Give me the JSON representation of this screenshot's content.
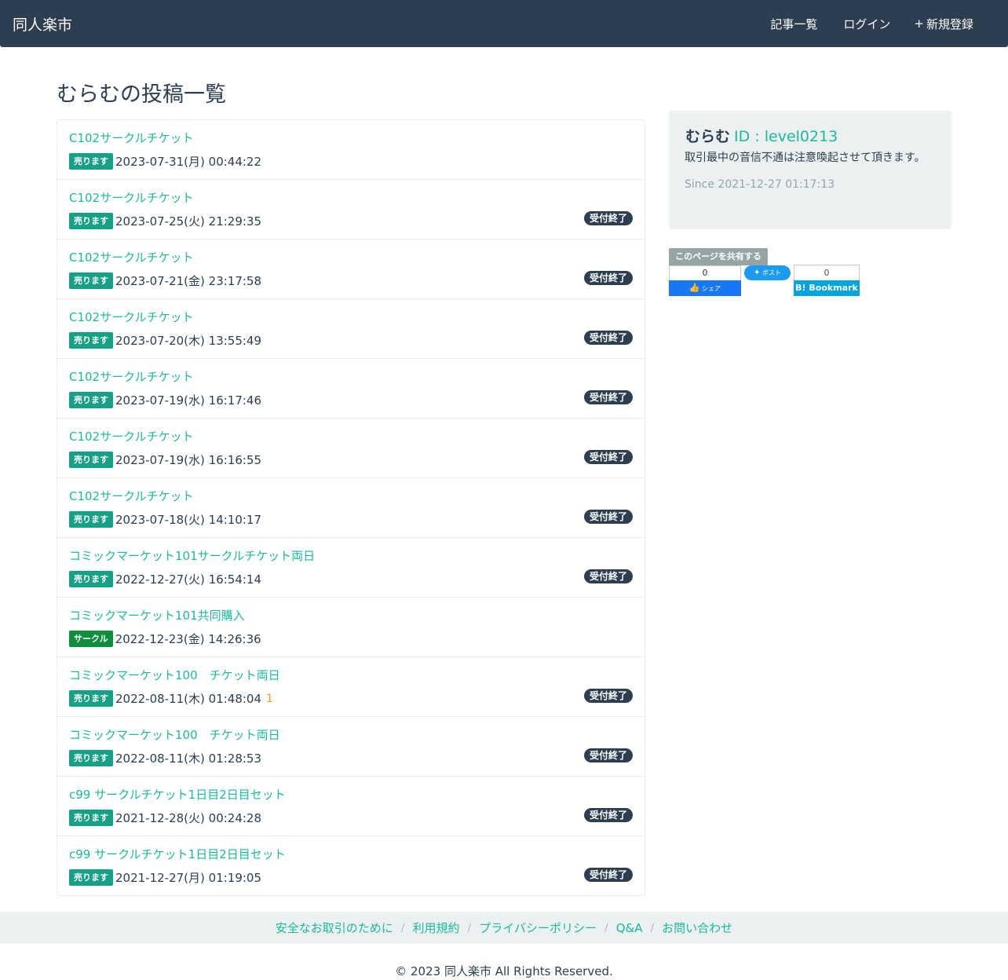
{
  "navbar": {
    "brand": "同人楽市",
    "links": [
      {
        "icon": "",
        "label": "記事一覧"
      },
      {
        "icon": "",
        "label": "ログイン"
      },
      {
        "icon": "+",
        "label": "新規登録"
      }
    ]
  },
  "page_title": "むらむの投稿一覧",
  "closed_label": "受付終了",
  "posts": [
    {
      "title": "C102サークルチケット",
      "tag": "売ります",
      "tag_type": "sell",
      "date": "2023-07-31(月) 00:44:22",
      "closed": false,
      "comments": ""
    },
    {
      "title": "C102サークルチケット",
      "tag": "売ります",
      "tag_type": "sell",
      "date": "2023-07-25(火) 21:29:35",
      "closed": true,
      "comments": ""
    },
    {
      "title": "C102サークルチケット",
      "tag": "売ります",
      "tag_type": "sell",
      "date": "2023-07-21(金) 23:17:58",
      "closed": true,
      "comments": ""
    },
    {
      "title": "C102サークルチケット",
      "tag": "売ります",
      "tag_type": "sell",
      "date": "2023-07-20(木) 13:55:49",
      "closed": true,
      "comments": ""
    },
    {
      "title": "C102サークルチケット",
      "tag": "売ります",
      "tag_type": "sell",
      "date": "2023-07-19(水) 16:17:46",
      "closed": true,
      "comments": ""
    },
    {
      "title": "C102サークルチケット",
      "tag": "売ります",
      "tag_type": "sell",
      "date": "2023-07-19(水) 16:16:55",
      "closed": true,
      "comments": ""
    },
    {
      "title": "C102サークルチケット",
      "tag": "売ります",
      "tag_type": "sell",
      "date": "2023-07-18(火) 14:10:17",
      "closed": true,
      "comments": ""
    },
    {
      "title": "コミックマーケット101サークルチケット両日",
      "tag": "売ります",
      "tag_type": "sell",
      "date": "2022-12-27(火) 16:54:14",
      "closed": true,
      "comments": ""
    },
    {
      "title": "コミックマーケット101共同購入",
      "tag": "サークル",
      "tag_type": "circle",
      "date": "2022-12-23(金) 14:26:36",
      "closed": false,
      "comments": ""
    },
    {
      "title": "コミックマーケット100　チケット両日",
      "tag": "売ります",
      "tag_type": "sell",
      "date": "2022-08-11(木) 01:48:04",
      "closed": true,
      "comments": "1"
    },
    {
      "title": "コミックマーケット100　チケット両日",
      "tag": "売ります",
      "tag_type": "sell",
      "date": "2022-08-11(木) 01:28:53",
      "closed": true,
      "comments": ""
    },
    {
      "title": "c99 サークルチケット1日目2日目セット",
      "tag": "売ります",
      "tag_type": "sell",
      "date": "2021-12-28(火) 00:24:28",
      "closed": true,
      "comments": ""
    },
    {
      "title": "c99 サークルチケット1日目2日目セット",
      "tag": "売ります",
      "tag_type": "sell",
      "date": "2021-12-27(月) 01:19:05",
      "closed": true,
      "comments": ""
    }
  ],
  "profile": {
    "name": "むらむ",
    "id_text": "ID : level0213",
    "description": "取引最中の音信不通は注意喚起させて頂きます。",
    "since": "Since 2021-12-27 01:17:13"
  },
  "share": {
    "label": "このページを共有する",
    "facebook_count": "0",
    "facebook_label": "シェア",
    "twitter_label": "ポスト",
    "hatena_count": "0",
    "hatena_label": "B! Bookmark"
  },
  "footer": {
    "links": [
      "安全なお取引のために",
      "利用規約",
      "プライバシーポリシー",
      "Q&A",
      "お問い合わせ"
    ],
    "separator": "/",
    "copyright": "© 2023 同人楽市 All Rights Reserved."
  },
  "colors": {
    "navbar": "#2c3e50",
    "accent": "#18bc9c",
    "sell_tag": "#16a085",
    "circle_tag": "#0e8f3e",
    "closed_badge": "#2c3e50",
    "comment": "#f39c12"
  }
}
